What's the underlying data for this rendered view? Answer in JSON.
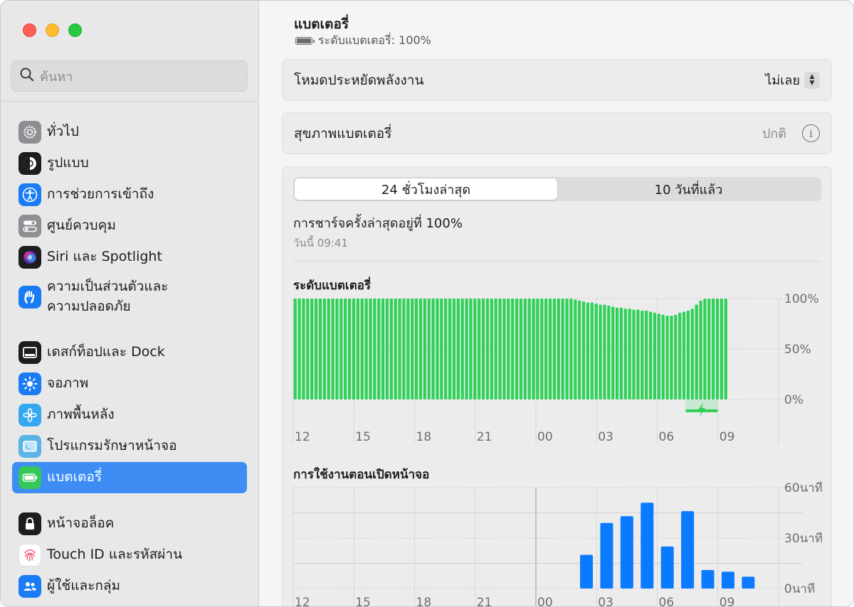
{
  "sidebar": {
    "search_placeholder": "ค้นหา",
    "items": [
      {
        "label": "ทั่วไป",
        "icon": "gear-icon",
        "color": "#8e8e93"
      },
      {
        "label": "รูปแบบ",
        "icon": "appearance-icon",
        "color": "#1d1d1f"
      },
      {
        "label": "การช่วยการเข้าถึง",
        "icon": "accessibility-icon",
        "color": "#1a7cf5"
      },
      {
        "label": "ศูนย์ควบคุม",
        "icon": "control-center-icon",
        "color": "#8e8e93"
      },
      {
        "label": "Siri และ Spotlight",
        "icon": "siri-icon",
        "color": "#2b2b2b"
      },
      {
        "label": "ความเป็นส่วนตัวและ",
        "label2": "ความปลอดภัย",
        "icon": "privacy-hand-icon",
        "color": "#1a7cf5"
      },
      {
        "label": "เดสก์ท็อปและ Dock",
        "icon": "dock-icon",
        "color": "#1d1d1f"
      },
      {
        "label": "จอภาพ",
        "icon": "display-sun-icon",
        "color": "#1a7cf5"
      },
      {
        "label": "ภาพพื้นหลัง",
        "icon": "wallpaper-flower-icon",
        "color": "#34a7f0"
      },
      {
        "label": "โปรแกรมรักษาหน้าจอ",
        "icon": "screensaver-icon",
        "color": "#5ab4e6"
      },
      {
        "label": "แบตเตอรี่",
        "icon": "battery-icon",
        "color": "#34c759",
        "active": true
      },
      {
        "label": "หน้าจอล็อค",
        "icon": "lock-icon",
        "color": "#1d1d1f"
      },
      {
        "label": "Touch ID และรหัสผ่าน",
        "icon": "fingerprint-icon",
        "color": "#ffffff"
      },
      {
        "label": "ผู้ใช้และกลุ่ม",
        "icon": "users-icon",
        "color": "#1a7cf5"
      }
    ]
  },
  "header": {
    "title": "แบตเตอรี่",
    "level_text": "ระดับแบตเตอรี่: 100%"
  },
  "low_power": {
    "label": "โหมดประหยัดพลังงาน",
    "value": "ไม่เลย"
  },
  "health": {
    "label": "สุขภาพแบตเตอรี่",
    "value": "ปกติ"
  },
  "usage": {
    "tabs": [
      "24 ชั่วโมงล่าสุด",
      "10 วันที่แล้ว"
    ],
    "selected_tab": 0,
    "last_charge": "การชาร์จครั้งล่าสุดอยู่ที่ 100%",
    "last_charge_time": "วันนี้ 09:41"
  },
  "chart_data": [
    {
      "type": "bar",
      "title": "ระดับแบตเตอรี่",
      "color": "#30d158",
      "x_ticks": [
        "12",
        "15",
        "18",
        "21",
        "00",
        "03",
        "06",
        "09"
      ],
      "y_ticks": [
        "100%",
        "50%",
        "0%"
      ],
      "ylim": [
        0,
        100
      ],
      "charging_segment_hours": [
        7.4,
        9.0
      ],
      "values": [
        100,
        100,
        100,
        100,
        100,
        100,
        100,
        100,
        100,
        100,
        100,
        100,
        100,
        100,
        100,
        100,
        100,
        100,
        100,
        100,
        100,
        100,
        100,
        100,
        100,
        100,
        100,
        100,
        100,
        100,
        100,
        100,
        100,
        100,
        100,
        100,
        100,
        100,
        100,
        100,
        100,
        100,
        100,
        100,
        100,
        100,
        100,
        100,
        100,
        100,
        100,
        100,
        100,
        100,
        100,
        100,
        100,
        100,
        100,
        100,
        100,
        100,
        100,
        100,
        100,
        100,
        100,
        99,
        98,
        97,
        96,
        96,
        95,
        94,
        94,
        93,
        92,
        91,
        91,
        90,
        90,
        89,
        89,
        88,
        88,
        87,
        86,
        85,
        84,
        83,
        83,
        84,
        86,
        87,
        88,
        90,
        94,
        98,
        100,
        100,
        100,
        100,
        100,
        100
      ]
    },
    {
      "type": "bar",
      "title": "การใช้งานตอนเปิดหน้าจอ",
      "color": "#0a7aff",
      "x_ticks": [
        "12",
        "15",
        "18",
        "21",
        "00",
        "03",
        "06",
        "09"
      ],
      "y_ticks": [
        "60นาที",
        "30นาที",
        "0นาที"
      ],
      "ylim": [
        0,
        60
      ],
      "hours": [
        2,
        3,
        4,
        5,
        6,
        7,
        8,
        9
      ],
      "values": [
        20,
        39,
        43,
        51,
        25,
        46,
        11,
        10,
        7
      ]
    }
  ]
}
